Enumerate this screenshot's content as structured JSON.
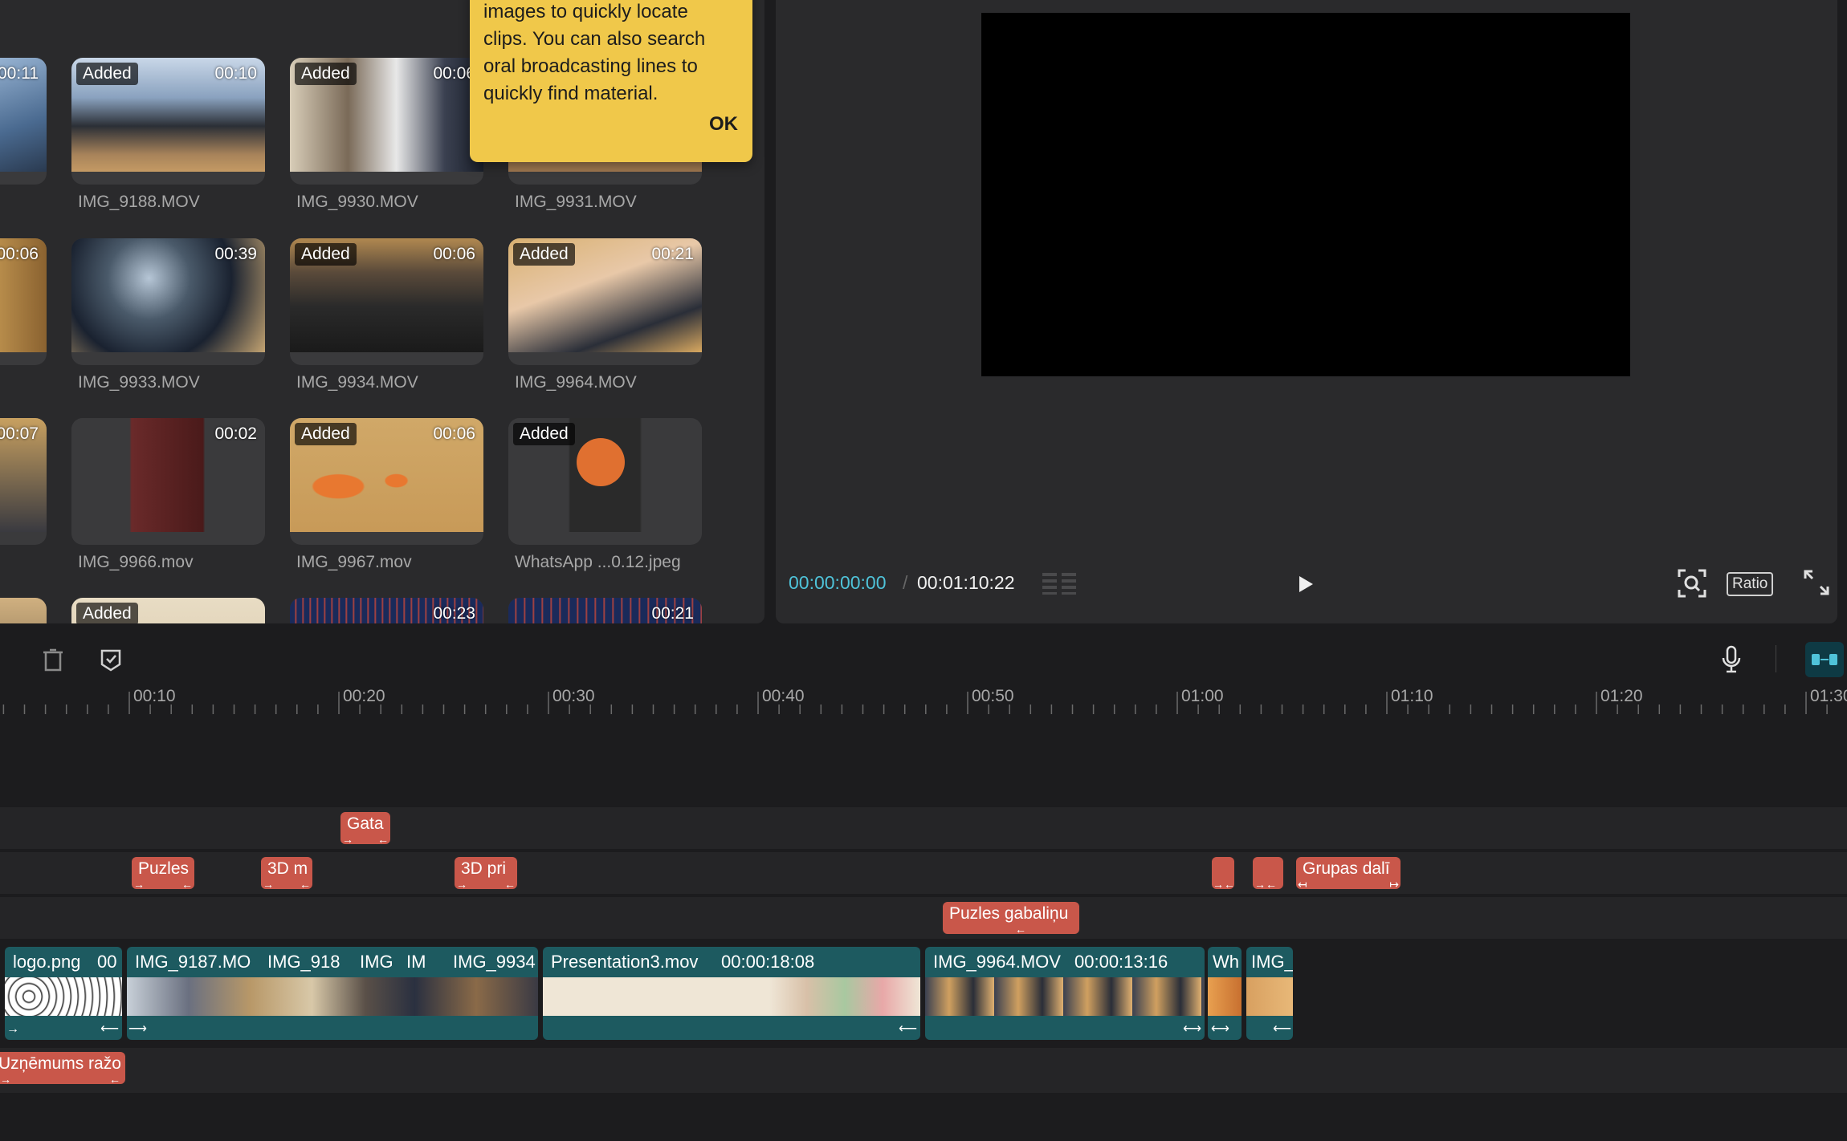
{
  "media": {
    "tooltip": {
      "lines": [
        "images to quickly locate",
        "clips. You can also search",
        "oral broadcasting lines to",
        "quickly find material."
      ],
      "ok_label": "OK"
    },
    "clips": [
      {
        "name": "",
        "duration": "00:11",
        "added": false
      },
      {
        "name": "IMG_9188.MOV",
        "duration": "00:10",
        "added": true
      },
      {
        "name": "IMG_9930.MOV",
        "duration": "00:06",
        "added": true
      },
      {
        "name": "IMG_9931.MOV",
        "duration": "",
        "added": false
      },
      {
        "name": "",
        "duration": "00:06",
        "added": false
      },
      {
        "name": "IMG_9933.MOV",
        "duration": "00:39",
        "added": false
      },
      {
        "name": "IMG_9934.MOV",
        "duration": "00:06",
        "added": true
      },
      {
        "name": "IMG_9964.MOV",
        "duration": "00:21",
        "added": true
      },
      {
        "name": "",
        "duration": "00:07",
        "added": false
      },
      {
        "name": "IMG_9966.mov",
        "duration": "00:02",
        "added": false
      },
      {
        "name": "IMG_9967.mov",
        "duration": "00:06",
        "added": true
      },
      {
        "name": "WhatsApp ...0.12.jpeg",
        "duration": "",
        "added": true
      },
      {
        "name": "",
        "duration": "",
        "added": false
      },
      {
        "name": "",
        "duration": "",
        "added": true
      },
      {
        "name": "",
        "duration": "00:23",
        "added": false
      },
      {
        "name": "",
        "duration": "00:21",
        "added": false
      }
    ],
    "added_label": "Added"
  },
  "player": {
    "current_time": "00:00:00:00",
    "separator": "/",
    "total_time": "00:01:10:22",
    "ratio_label": "Ratio"
  },
  "timeline": {
    "ruler": [
      "00:10",
      "00:20",
      "00:30",
      "00:40",
      "00:50",
      "01:00",
      "01:10",
      "01:20",
      "01:30"
    ],
    "text_tags": [
      {
        "label": "Gata"
      },
      {
        "label": "Puzles"
      },
      {
        "label": "3D m"
      },
      {
        "label": "3D pri"
      },
      {
        "label": ""
      },
      {
        "label": ""
      },
      {
        "label": "Grupas dalī"
      },
      {
        "label": "Puzles gabaliņu"
      },
      {
        "label": "Uzņēmums ražo"
      }
    ],
    "clips": [
      {
        "name": "logo.png",
        "duration": "00"
      },
      {
        "name": "IMG_9187.MO",
        "duration": ""
      },
      {
        "name": "IMG_918",
        "duration": ""
      },
      {
        "name": "IMG",
        "duration": ""
      },
      {
        "name": "IM",
        "duration": ""
      },
      {
        "name": "IMG_9934",
        "duration": ""
      },
      {
        "name": "Presentation3.mov",
        "duration": "00:00:18:08"
      },
      {
        "name": "IMG_9964.MOV",
        "duration": "00:00:13:16"
      },
      {
        "name": "Wh",
        "duration": ""
      },
      {
        "name": "IMG_",
        "duration": ""
      }
    ]
  },
  "colors": {
    "accent_timecode": "#4fc3d9",
    "tag_red": "#c9574a",
    "clip_teal": "#1d5a60",
    "tooltip_yellow": "#f0c84a"
  }
}
